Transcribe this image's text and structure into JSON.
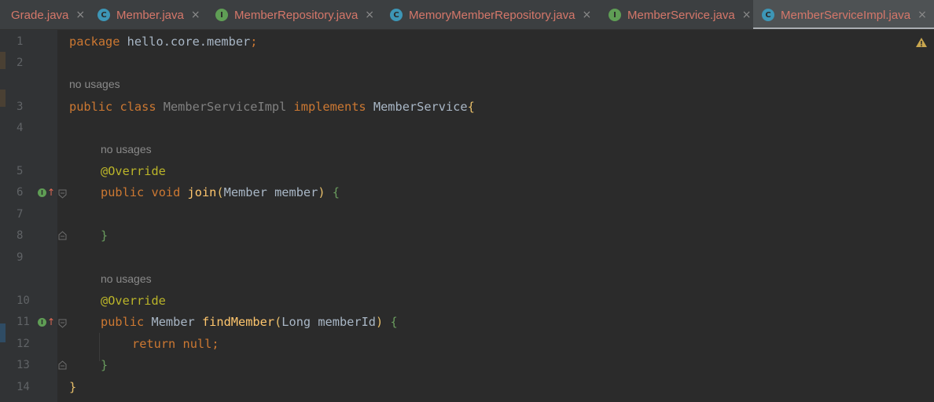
{
  "tabs": [
    {
      "label": "Grade.java",
      "kind": "enum",
      "icon": "",
      "active": false
    },
    {
      "label": "Member.java",
      "kind": "class",
      "icon": "C",
      "active": false
    },
    {
      "label": "MemberRepository.java",
      "kind": "interface",
      "icon": "I",
      "active": false
    },
    {
      "label": "MemoryMemberRepository.java",
      "kind": "class",
      "icon": "C",
      "active": false
    },
    {
      "label": "MemberService.java",
      "kind": "interface",
      "icon": "I",
      "active": false
    },
    {
      "label": "MemberServiceImpl.java",
      "kind": "class",
      "icon": "C",
      "active": true
    }
  ],
  "tab_close_glyph": "×",
  "editor": {
    "line_numbers": [
      "1",
      "2",
      "3",
      "4",
      "5",
      "6",
      "7",
      "8",
      "9",
      "10",
      "11",
      "12",
      "13",
      "14"
    ],
    "usage_hint": "no usages",
    "line1": {
      "kw": "package",
      "rest": " hello.core.member",
      "semi": ";"
    },
    "line3": {
      "kw1": "public",
      "kw2": "class",
      "classname": "MemberServiceImpl",
      "kw3": "implements",
      "iface": "MemberService",
      "brace": "{"
    },
    "annotation": "@Override",
    "line6": {
      "kw1": "public",
      "kw2": "void",
      "method": "join",
      "params": "Member member",
      "open_paren": "(",
      "close_paren": ")",
      "brace": "{"
    },
    "line8": {
      "brace": "}"
    },
    "line11": {
      "kw1": "public",
      "type": "Member",
      "method": "findMember",
      "params": "Long memberId",
      "open_paren": "(",
      "close_paren": ")",
      "brace": "{"
    },
    "line12": {
      "kw": "return",
      "kw2": "null",
      "semi": ";"
    },
    "line13": {
      "brace": "}"
    },
    "line14": {
      "brace": "}"
    }
  },
  "colors": {
    "background": "#2b2b2b",
    "keyword": "#cc7832",
    "annotation": "#bbb529",
    "method": "#ffc66d",
    "default": "#a9b7c6",
    "tab_text": "#d5776a"
  }
}
